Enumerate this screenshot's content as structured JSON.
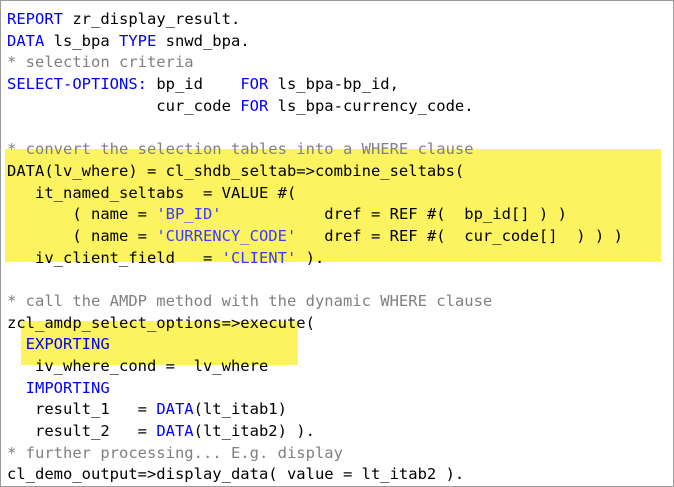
{
  "editor": {
    "lines": [
      [
        {
          "t": "REPORT",
          "c": "kw"
        },
        {
          "t": " zr_display_result.",
          "c": "id"
        }
      ],
      [
        {
          "t": "DATA",
          "c": "kw"
        },
        {
          "t": " ls_bpa ",
          "c": "id"
        },
        {
          "t": "TYPE",
          "c": "kw"
        },
        {
          "t": " snwd_bpa.",
          "c": "id"
        }
      ],
      [
        {
          "t": "* selection criteria",
          "c": "cm"
        }
      ],
      [
        {
          "t": "SELECT-OPTIONS:",
          "c": "kw"
        },
        {
          "t": " bp_id    ",
          "c": "id"
        },
        {
          "t": "FOR",
          "c": "kw"
        },
        {
          "t": " ls_bpa-bp_id,",
          "c": "id"
        }
      ],
      [
        {
          "t": "                cur_code ",
          "c": "id"
        },
        {
          "t": "FOR",
          "c": "kw"
        },
        {
          "t": " ls_bpa-currency_code.",
          "c": "id"
        }
      ],
      [
        {
          "t": "",
          "c": "id"
        }
      ],
      [
        {
          "t": "* convert the selection tables into a WHERE clause",
          "c": "cm"
        }
      ],
      [
        {
          "t": "DATA(lv_where) = cl_shdb_seltab=>combine_seltabs(",
          "c": "id"
        }
      ],
      [
        {
          "t": "   it_named_seltabs  = VALUE #(",
          "c": "id"
        }
      ],
      [
        {
          "t": "       ( name = ",
          "c": "id"
        },
        {
          "t": "'BP_ID'",
          "c": "st"
        },
        {
          "t": "           dref = REF #(  bp_id[] ) )",
          "c": "id"
        }
      ],
      [
        {
          "t": "       ( name = ",
          "c": "id"
        },
        {
          "t": "'CURRENCY_CODE'",
          "c": "st"
        },
        {
          "t": "   dref = REF #(  cur_code[]  ) ) )",
          "c": "id"
        }
      ],
      [
        {
          "t": "   iv_client_field   = ",
          "c": "id"
        },
        {
          "t": "'CLIENT'",
          "c": "st"
        },
        {
          "t": " ).",
          "c": "id"
        }
      ],
      [
        {
          "t": "",
          "c": "id"
        }
      ],
      [
        {
          "t": "* call the AMDP method with the dynamic WHERE clause",
          "c": "cm"
        }
      ],
      [
        {
          "t": "zcl_amdp_select_options=>execute(",
          "c": "id"
        }
      ],
      [
        {
          "t": "  EXPORTING",
          "c": "kw"
        }
      ],
      [
        {
          "t": "   iv_where_cond =  lv_where",
          "c": "id"
        }
      ],
      [
        {
          "t": "  IMPORTING",
          "c": "kw"
        }
      ],
      [
        {
          "t": "   result_1   = ",
          "c": "id"
        },
        {
          "t": "DATA",
          "c": "kw"
        },
        {
          "t": "(lt_itab1)",
          "c": "id"
        }
      ],
      [
        {
          "t": "   result_2   = ",
          "c": "id"
        },
        {
          "t": "DATA",
          "c": "kw"
        },
        {
          "t": "(lt_itab2) ).",
          "c": "id"
        }
      ],
      [
        {
          "t": "* further processing... E.g. display",
          "c": "cm"
        }
      ],
      [
        {
          "t": "cl_demo_output=>display_data( value = lt_itab2 ).",
          "c": "id"
        }
      ]
    ]
  },
  "colors": {
    "keyword": "#0000ff",
    "comment": "#808080",
    "string": "#3b3bff",
    "highlight": "#fbf35f"
  }
}
